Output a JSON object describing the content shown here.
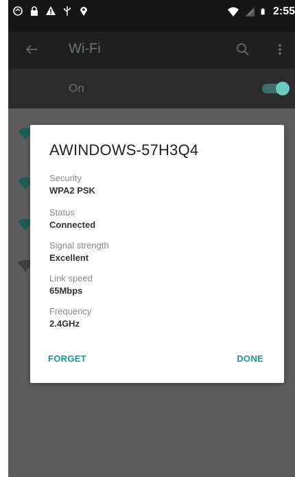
{
  "status_bar": {
    "time": "2:55"
  },
  "toolbar": {
    "title": "Wi-Fi",
    "icons": [
      "back-arrow-icon",
      "search-icon",
      "more-vert-icon"
    ]
  },
  "master_switch": {
    "label": "On",
    "state": "on"
  },
  "dialog": {
    "title": "AWINDOWS-57H3Q4",
    "fields": [
      {
        "label": "Security",
        "value": "WPA2 PSK"
      },
      {
        "label": "Status",
        "value": "Connected"
      },
      {
        "label": "Signal strength",
        "value": "Excellent"
      },
      {
        "label": "Link speed",
        "value": "65Mbps"
      },
      {
        "label": "Frequency",
        "value": "2.4GHz"
      }
    ],
    "forget_label": "FORGET",
    "done_label": "DONE"
  },
  "colors": {
    "accent": "#159a8f",
    "toolbar_bg": "#1f1f1f",
    "scrim": "#5d5d5d"
  }
}
